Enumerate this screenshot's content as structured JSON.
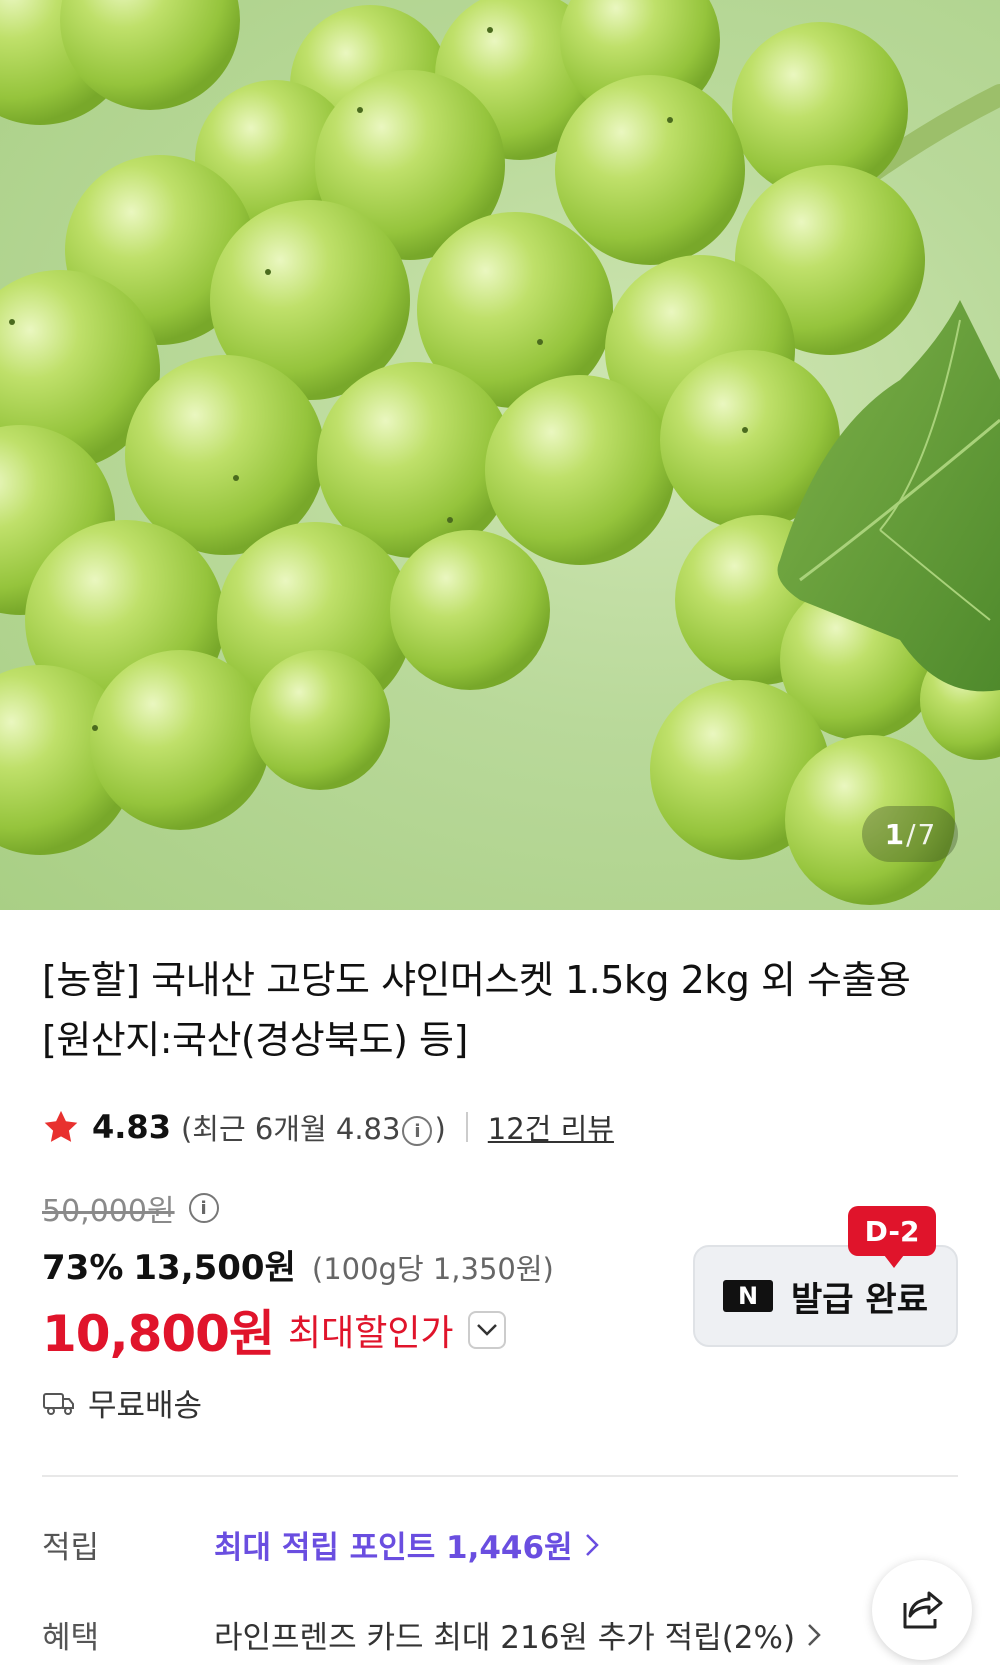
{
  "hero": {
    "image_subject": "shine-muscat-grapes",
    "pager_current": "1",
    "pager_sep": "/",
    "pager_total": "7"
  },
  "product": {
    "title": "[농할] 국내산 고당도 샤인머스켓 1.5kg 2kg 외 수출용 [원산지:국산(경상북도) 등]"
  },
  "rating": {
    "score": "4.83",
    "recent_prefix": "(최근 6개월 4.83",
    "recent_suffix": ")",
    "reviews": "12건 리뷰",
    "star_color": "#e8312f"
  },
  "price": {
    "original": "50,000원",
    "discount_pct": "73%",
    "sale": "13,500원",
    "unit_price": "(100g당 1,350원)",
    "max_discount_price": "10,800원",
    "max_discount_label": "최대할인가",
    "accent_color": "#e0142b"
  },
  "coupon": {
    "brand_mark": "N",
    "status": "발급 완료",
    "dday": "D-2"
  },
  "shipping": {
    "label": "무료배송",
    "icon": "truck-icon"
  },
  "benefits": {
    "points_key": "적립",
    "points_value": "최대 적립 포인트 1,446원",
    "points_color": "#6a4ee0",
    "perks_key": "혜택",
    "perks_value": "라인프렌즈 카드 최대 216원 추가 적립(2%)"
  },
  "actions": {
    "share_icon": "share-icon"
  }
}
